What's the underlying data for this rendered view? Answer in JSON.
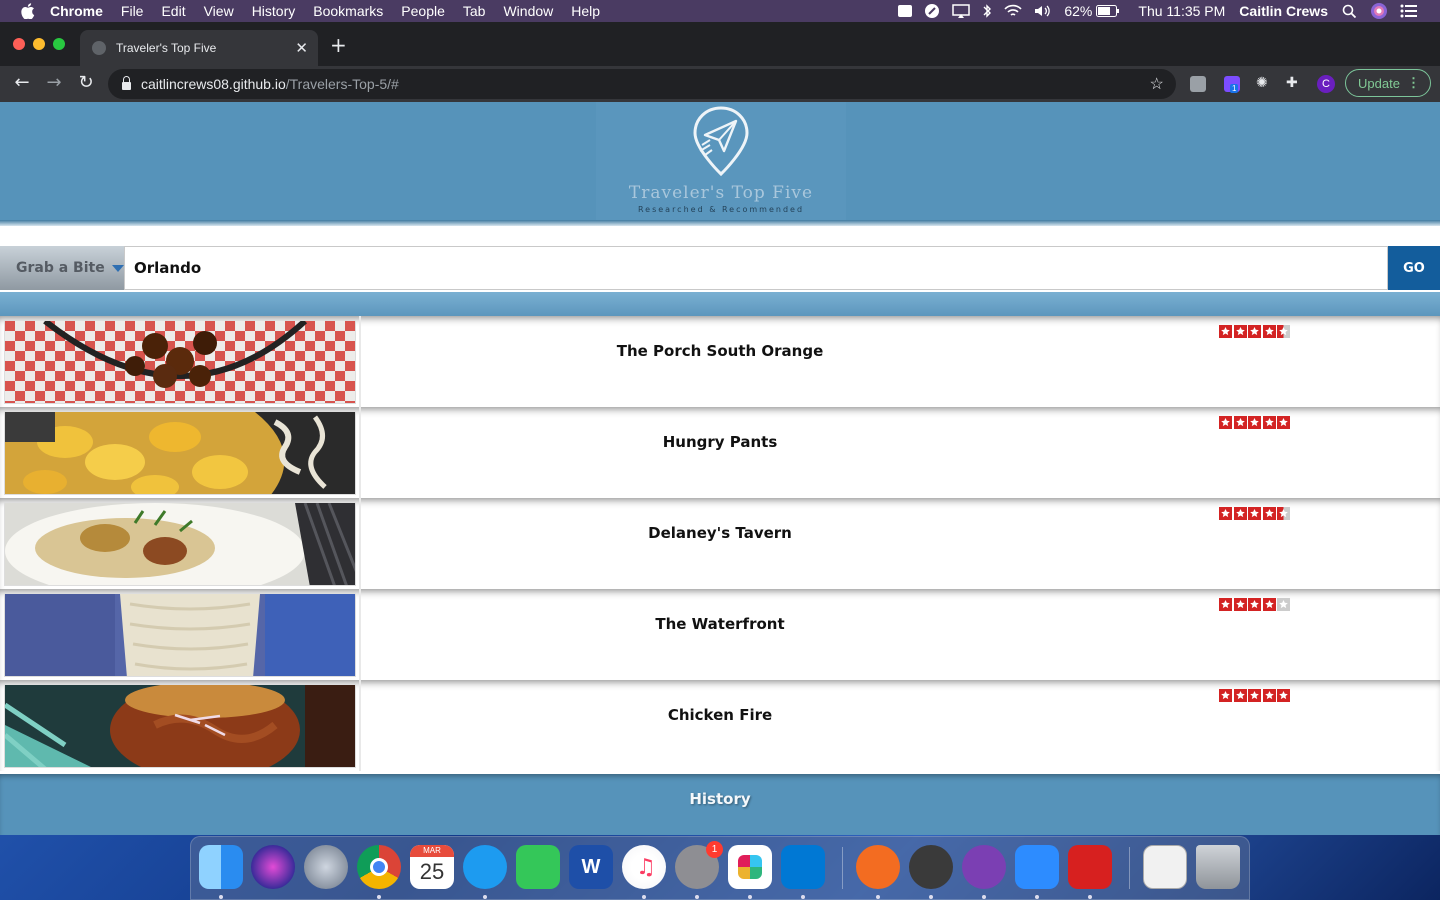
{
  "menubar": {
    "app_name": "Chrome",
    "menus": [
      "File",
      "Edit",
      "View",
      "History",
      "Bookmarks",
      "People",
      "Tab",
      "Window",
      "Help"
    ],
    "battery": "62%",
    "clock": "Thu 11:35 PM",
    "user": "Caitlin Crews"
  },
  "browser": {
    "tab_title": "Traveler's Top Five",
    "url_host": "caitlincrews08.github.io",
    "url_path": "/Travelers-Top-5/#",
    "update_label": "Update",
    "profile_initial": "C",
    "extension_badge": "1"
  },
  "site": {
    "logo_title": "Traveler's Top Five",
    "logo_subtitle": "Researched & Recommended",
    "category_label": "Grab a Bite",
    "search_value": "Orlando",
    "go_label": "GO",
    "footer_link": "History"
  },
  "results": [
    {
      "name": "The Porch South Orange",
      "rating": 4.5
    },
    {
      "name": "Hungry Pants",
      "rating": 5
    },
    {
      "name": "Delaney's Tavern",
      "rating": 4.5
    },
    {
      "name": "The Waterfront",
      "rating": 4
    },
    {
      "name": "Chicken Fire",
      "rating": 5
    }
  ],
  "colors": {
    "header": "#5693ba",
    "go_button": "#135d9c",
    "star_filled": "#d32323",
    "star_empty": "#cccccc"
  },
  "dock": {
    "calendar_month": "MAR",
    "calendar_day": "25",
    "settings_badge": "1"
  }
}
